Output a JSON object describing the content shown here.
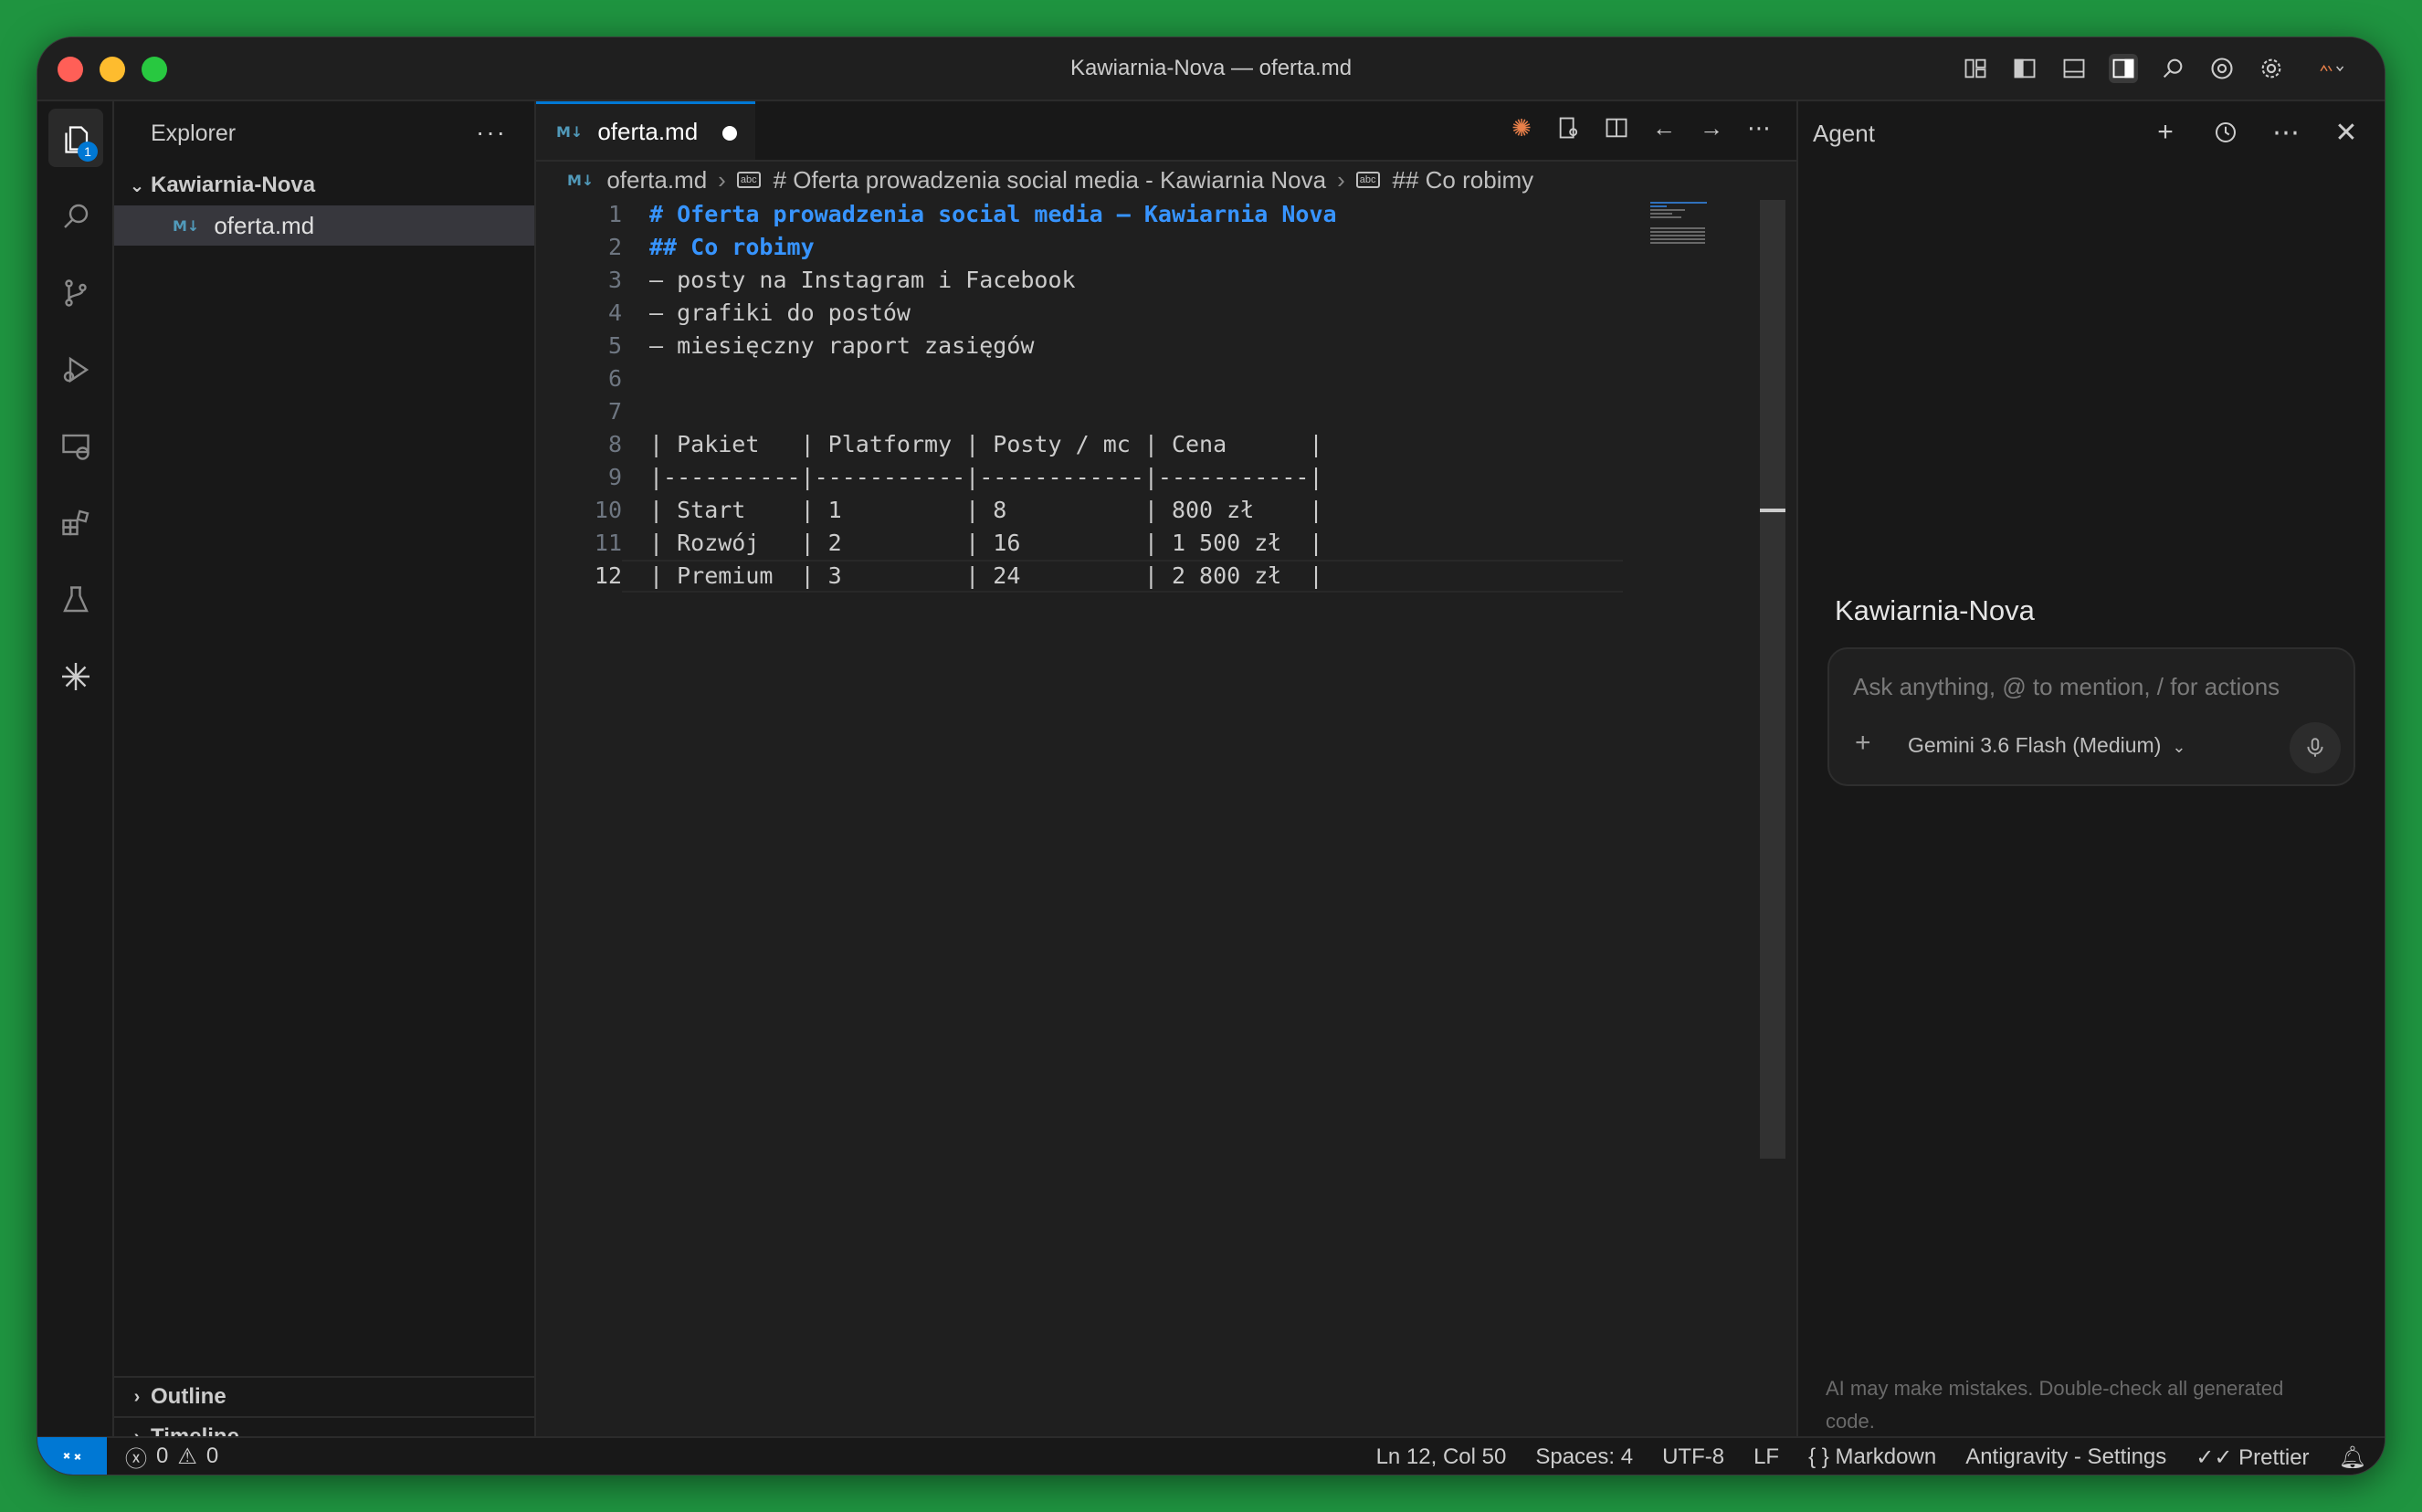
{
  "window": {
    "title": "Kawiarnia-Nova — oferta.md"
  },
  "sidebar": {
    "header": "Explorer",
    "more": "···",
    "folder": "Kawiarnia-Nova",
    "file": "oferta.md",
    "outline": "Outline",
    "timeline": "Timeline"
  },
  "activity": {
    "explorer_badge": "1"
  },
  "editor": {
    "tab_label": "oferta.md",
    "md_icon": "M↓",
    "breadcrumb": {
      "file": "oferta.md",
      "h1": "# Oferta prowadzenia social media - Kawiarnia Nova",
      "h2": "## Co robimy"
    },
    "lines": [
      {
        "n": "1",
        "text": "# Oferta prowadzenia social media – Kawiarnia Nova"
      },
      {
        "n": "2",
        "text": "## Co robimy"
      },
      {
        "n": "3",
        "text": "– posty na Instagram i Facebook"
      },
      {
        "n": "4",
        "text": "– grafiki do postów"
      },
      {
        "n": "5",
        "text": "– miesięczny raport zasięgów"
      },
      {
        "n": "6",
        "text": ""
      },
      {
        "n": "7",
        "text": ""
      },
      {
        "n": "8",
        "text": "| Pakiet   | Platformy | Posty / mc | Cena      |"
      },
      {
        "n": "9",
        "text": "|----------|-----------|------------|-----------|"
      },
      {
        "n": "10",
        "text": "| Start    | 1         | 8          | 800 zł    |"
      },
      {
        "n": "11",
        "text": "| Rozwój   | 2         | 16         | 1 500 zł  |"
      },
      {
        "n": "12",
        "text": "| Premium  | 3         | 24         | 2 800 zł  |"
      }
    ]
  },
  "agent": {
    "header": "Agent",
    "workspace": "Kawiarnia-Nova",
    "placeholder": "Ask anything, @ to mention, / for actions",
    "model": "Gemini 3.6 Flash (Medium)",
    "footer": "AI may make mistakes. Double-check all generated code."
  },
  "status": {
    "errors": "0",
    "warnings": "0",
    "position": "Ln 12, Col 50",
    "spaces": "Spaces: 4",
    "encoding": "UTF-8",
    "eol": "LF",
    "language": "Markdown",
    "settings": "Antigravity - Settings",
    "prettier": "Prettier"
  },
  "colors": {
    "accent": "#0078d4",
    "heading": "#3794ff",
    "background_outer": "#1f9440"
  }
}
